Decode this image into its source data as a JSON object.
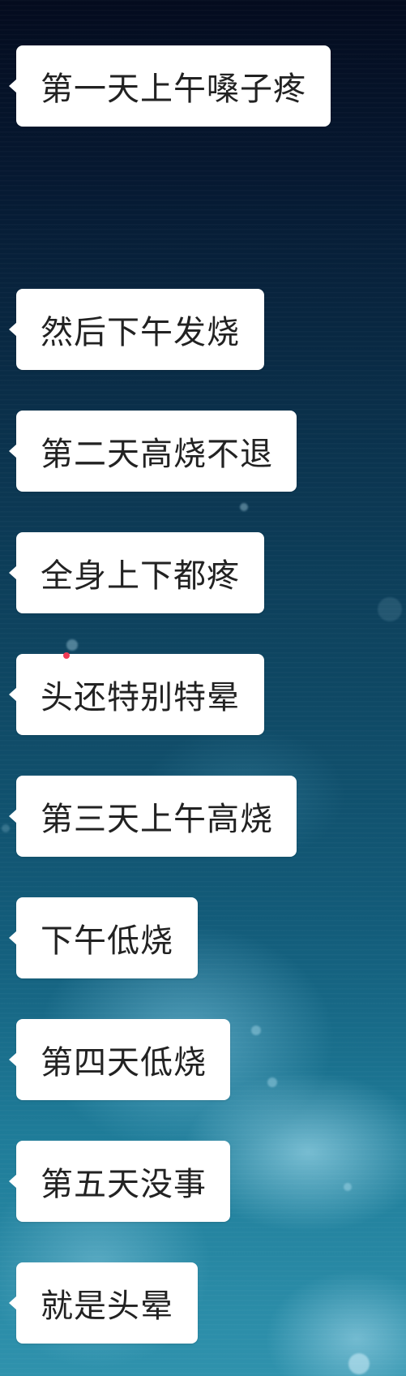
{
  "messages": [
    {
      "text": "第一天上午嗓子疼"
    },
    {
      "text": "然后下午发烧"
    },
    {
      "text": "第二天高烧不退"
    },
    {
      "text": "全身上下都疼"
    },
    {
      "text": "头还特别特晕"
    },
    {
      "text": "第三天上午高烧"
    },
    {
      "text": "下午低烧"
    },
    {
      "text": "第四天低烧"
    },
    {
      "text": "第五天没事"
    },
    {
      "text": "就是头晕"
    }
  ],
  "colors": {
    "bubble_bg": "#ffffff",
    "text": "#222222",
    "unread_dot": "#f03a55"
  }
}
